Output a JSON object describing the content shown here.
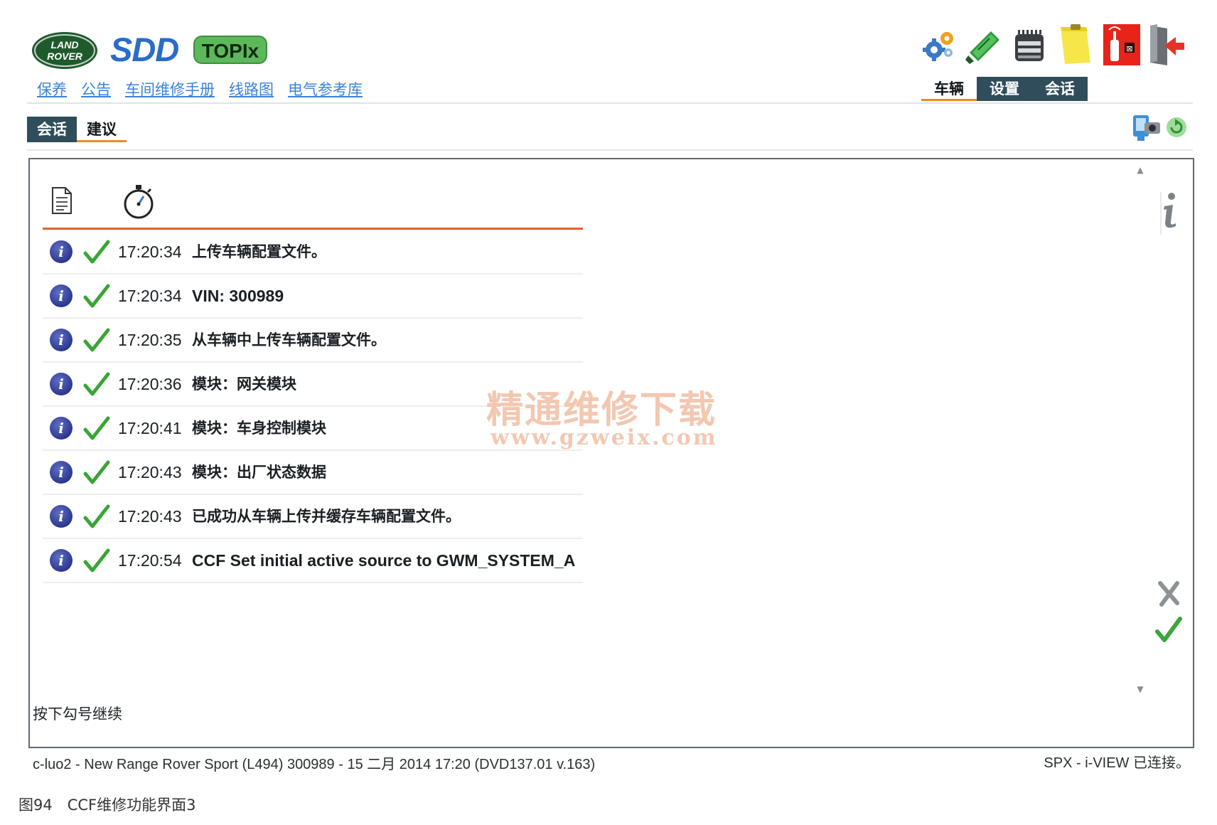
{
  "header": {
    "land_rover_logo_text": [
      "LAND",
      "ROVER"
    ],
    "sdd_logo": "SDD",
    "topix_logo": "TOPIx",
    "links": [
      "保养",
      "公告",
      "车间维修手册",
      "线路图",
      "电气参考库"
    ],
    "toolbar_icons": [
      "settings-gears-icon",
      "tool-card-icon",
      "vci-device-icon",
      "notes-icon",
      "wireless-disconnect-icon",
      "exit-door-icon"
    ],
    "main_tabs": [
      "车辆",
      "设置",
      "会话"
    ]
  },
  "sub_tabs": [
    "会话",
    "建议"
  ],
  "sub_toolbar_icons": [
    "screenshot-camera-icon",
    "refresh-icon"
  ],
  "log": {
    "columns": [
      "document-icon",
      "timer-icon"
    ],
    "rows": [
      {
        "time": "17:20:34",
        "message": "上传车辆配置文件。"
      },
      {
        "time": "17:20:34",
        "message": "VIN: 300989"
      },
      {
        "time": "17:20:35",
        "message": "从车辆中上传车辆配置文件。"
      },
      {
        "time": "17:20:36",
        "message": "模块：网关模块"
      },
      {
        "time": "17:20:41",
        "message": "模块：车身控制模块"
      },
      {
        "time": "17:20:43",
        "message": "模块：出厂状态数据"
      },
      {
        "time": "17:20:43",
        "message": "已成功从车辆上传并缓存车辆配置文件。"
      },
      {
        "time": "17:20:54",
        "message": "CCF Set initial active source to GWM_SYSTEM_A"
      }
    ]
  },
  "prompt": "按下勾号继续",
  "watermark": {
    "line1": "精通维修下载",
    "line2": "www.gzweix.com"
  },
  "status": {
    "left": "c-luo2 - New Range Rover Sport (L494) 300989 - 15 二月 2014 17:20 (DVD137.01 v.163)",
    "right": "SPX - i-VIEW 已连接。"
  },
  "caption": "图94　CCF维修功能界面3"
}
